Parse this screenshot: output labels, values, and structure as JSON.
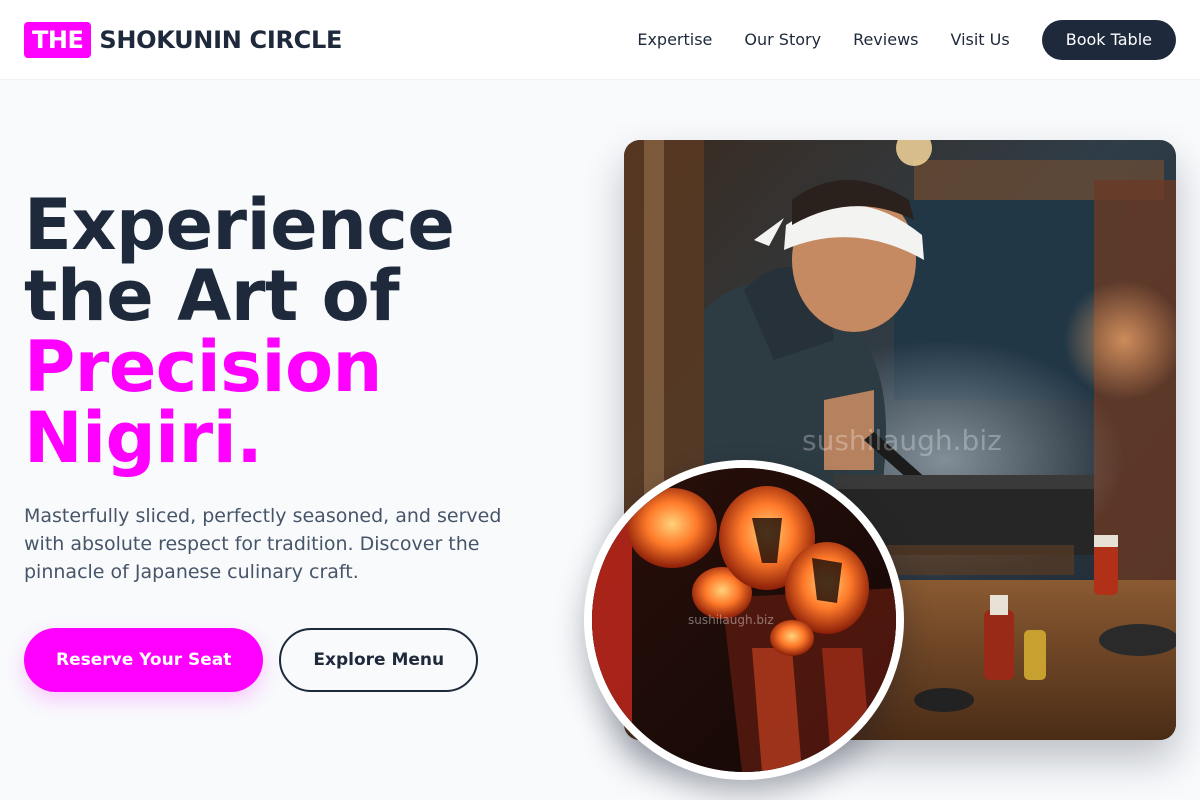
{
  "brand": {
    "badge": "THE",
    "name": "SHOKUNIN CIRCLE",
    "accent_color": "#ff00ff",
    "dark_color": "#1e293b"
  },
  "nav": {
    "items": [
      {
        "label": "Expertise"
      },
      {
        "label": "Our Story"
      },
      {
        "label": "Reviews"
      },
      {
        "label": "Visit Us"
      }
    ],
    "cta": "Book Table"
  },
  "hero": {
    "headline_line1": "Experience",
    "headline_line2": "the Art of",
    "headline_accent1": "Precision",
    "headline_accent2": "Nigiri.",
    "subtext": "Masterfully sliced, perfectly seasoned, and served with absolute respect for tradition. Discover the pinnacle of Japanese culinary craft.",
    "primary_cta": "Reserve Your Seat",
    "secondary_cta": "Explore Menu"
  },
  "images": {
    "main": {
      "subject": "chef-grilling-photo",
      "watermark": "sushilaugh.biz"
    },
    "inset": {
      "subject": "lanterns-photo",
      "watermark": "sushilaugh.biz"
    }
  }
}
